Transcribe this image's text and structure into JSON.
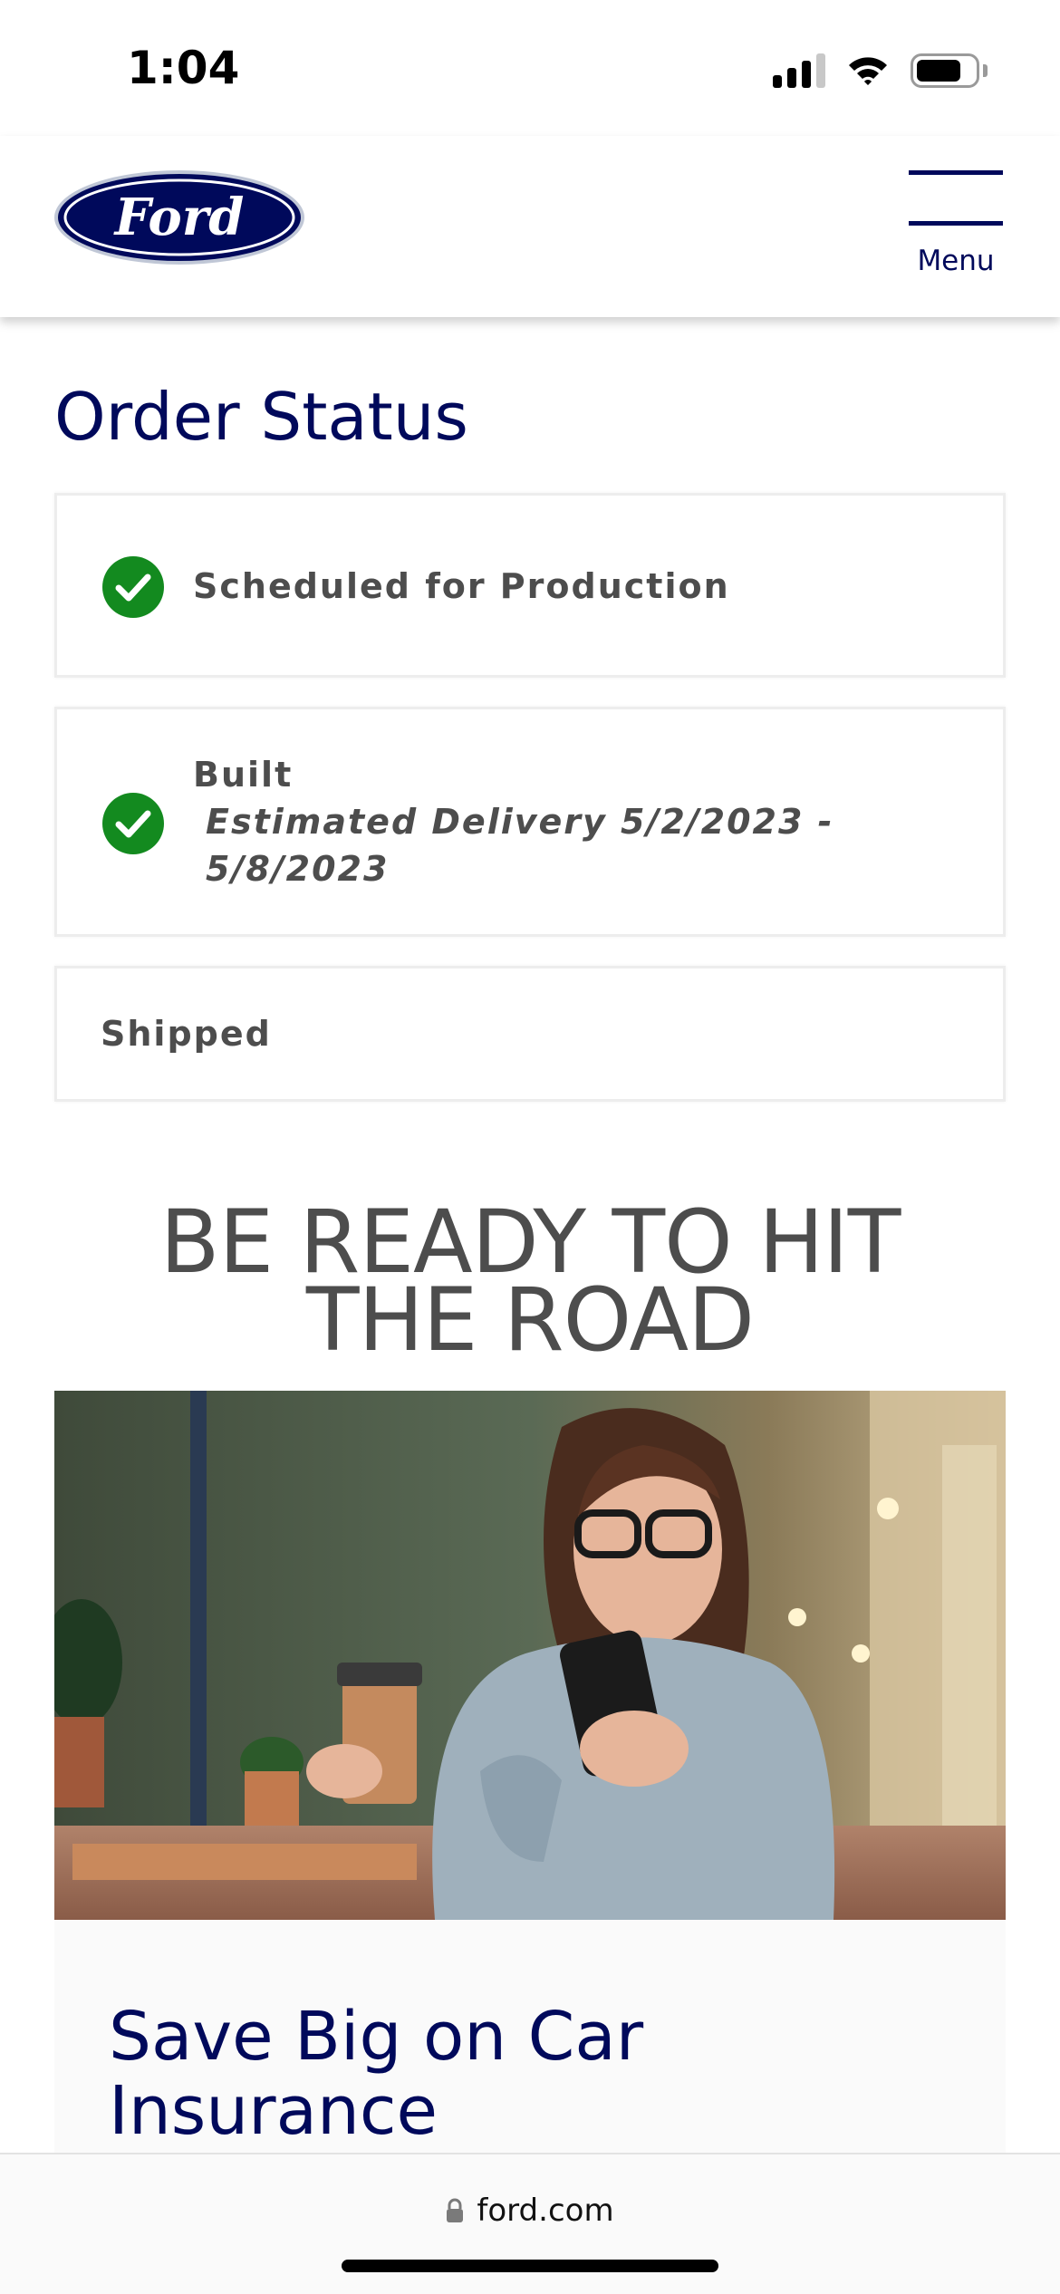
{
  "status_bar": {
    "time": "1:04"
  },
  "header": {
    "logo_text": "Ford",
    "menu_label": "Menu"
  },
  "order_status": {
    "title": "Order Status",
    "steps": [
      {
        "label": "Scheduled for Production",
        "completed": true
      },
      {
        "label": "Built",
        "sub_line1": "Estimated Delivery 5/2/2023 -",
        "sub_line2": "5/8/2023",
        "completed": true
      },
      {
        "label": "Shipped",
        "completed": false
      }
    ]
  },
  "promo": {
    "heading_line1": "BE READY TO HIT",
    "heading_line2": "THE ROAD",
    "card_title_line1": "Save Big on Car",
    "card_title_line2": "Insurance"
  },
  "browser": {
    "url": "ford.com"
  },
  "colors": {
    "ford_blue": "#00095b",
    "check_green": "#138a1f",
    "text_gray": "#4d4d4d"
  }
}
